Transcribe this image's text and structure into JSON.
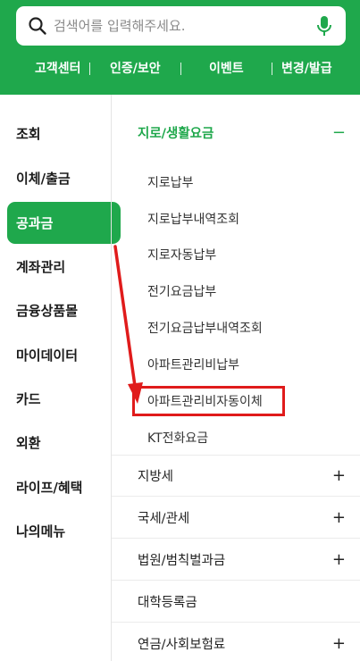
{
  "search": {
    "placeholder": "검색어를 입력해주세요."
  },
  "quick_menu": [
    {
      "label": "고객센터"
    },
    {
      "label": "인증/보안"
    },
    {
      "label": "이벤트"
    },
    {
      "label": "변경/발급"
    }
  ],
  "left_menu": [
    {
      "label": "조회"
    },
    {
      "label": "이체/출금"
    },
    {
      "label": "공과금",
      "active": true
    },
    {
      "label": "계좌관리"
    },
    {
      "label": "금융상품몰"
    },
    {
      "label": "마이데이터"
    },
    {
      "label": "카드"
    },
    {
      "label": "외환"
    },
    {
      "label": "라이프/혜택"
    },
    {
      "label": "나의메뉴"
    }
  ],
  "right_panel": {
    "open_category": {
      "label": "지로/생활요금",
      "sign": "−"
    },
    "sub_items": [
      {
        "label": "지로납부"
      },
      {
        "label": "지로납부내역조회"
      },
      {
        "label": "지로자동납부"
      },
      {
        "label": "전기요금납부"
      },
      {
        "label": "전기요금납부내역조회"
      },
      {
        "label": "아파트관리비납부"
      },
      {
        "label": "아파트관리비자동이체",
        "highlighted": true
      },
      {
        "label": "KT전화요금"
      }
    ],
    "categories": [
      {
        "label": "지방세",
        "sign": "+"
      },
      {
        "label": "국세/관세",
        "sign": "+"
      },
      {
        "label": "법원/범칙벌과금",
        "sign": "+"
      },
      {
        "label": "대학등록금",
        "sign": ""
      },
      {
        "label": "연금/사회보험료",
        "sign": "+"
      }
    ]
  },
  "colors": {
    "brand_green": "#1fa84c",
    "annotation_red": "#e01b1b"
  },
  "icons": {
    "search": "search-icon",
    "mic": "mic-icon"
  }
}
